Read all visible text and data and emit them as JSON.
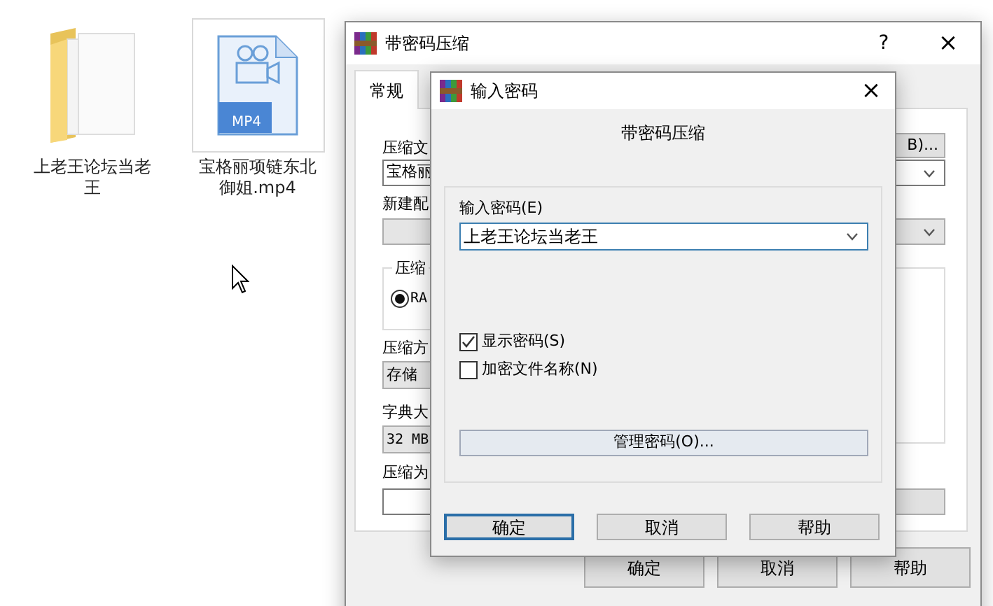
{
  "desktop_icons": [
    {
      "kind": "folder",
      "label": "上老王论坛当老王",
      "selected": false
    },
    {
      "kind": "video",
      "badge": "MP4",
      "label": "宝格丽项链东北御姐.mp4",
      "selected": true
    }
  ],
  "back_window": {
    "title": "带密码压缩",
    "help_button": "?",
    "close_button": "×",
    "tabs": [
      {
        "label": "常规",
        "selected": true
      }
    ],
    "archive_name_label": "压缩文",
    "browse_button": "B)...",
    "archive_name_value": "宝格丽",
    "profile_label": "新建配",
    "format_group_label": "压缩",
    "format_options": [
      {
        "label": "RA",
        "selected": true
      }
    ],
    "method_label": "压缩方",
    "method_value": "存储",
    "dictionary_label": "字典大",
    "dictionary_value": "32 MB",
    "split_label": "压缩为",
    "buttons": [
      "确定",
      "取消",
      "帮助"
    ]
  },
  "password_dialog": {
    "title": "输入密码",
    "close_button": "×",
    "heading": "带密码压缩",
    "password_label": "输入密码(E)",
    "password_value": "上老王论坛当老王",
    "options": [
      {
        "label": "显示密码(S)",
        "checked": true
      },
      {
        "label": "加密文件名称(N)",
        "checked": false
      }
    ],
    "manage_button": "管理密码(O)...",
    "buttons": [
      {
        "label": "确定",
        "default": true
      },
      {
        "label": "取消",
        "default": false
      },
      {
        "label": "帮助",
        "default": false
      }
    ]
  }
}
